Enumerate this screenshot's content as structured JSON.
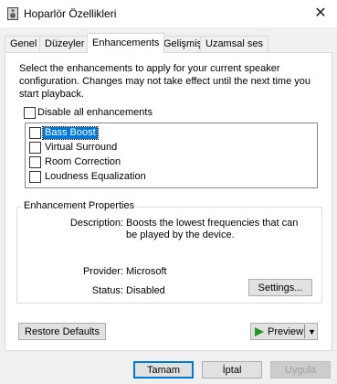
{
  "window": {
    "title": "Hoparlör Özellikleri",
    "close_label": "✕"
  },
  "tabs": [
    {
      "label": "Genel"
    },
    {
      "label": "Düzeyler"
    },
    {
      "label": "Enhancements",
      "active": true
    },
    {
      "label": "Gelişmiş"
    },
    {
      "label": "Uzamsal ses"
    }
  ],
  "enhancements": {
    "description": "Select the enhancements to apply for your current speaker configuration. Changes may not take effect until the next time you start playback.",
    "disable_all_label": "Disable all enhancements",
    "items": [
      {
        "label": "Bass Boost",
        "checked": false,
        "selected": true
      },
      {
        "label": "Virtual Surround",
        "checked": false
      },
      {
        "label": "Room Correction",
        "checked": false
      },
      {
        "label": "Loudness Equalization",
        "checked": false
      }
    ]
  },
  "properties": {
    "group_title": "Enhancement Properties",
    "description_label": "Description:",
    "description_value": "Boosts the lowest frequencies that can be played by the device.",
    "provider_label": "Provider:",
    "provider_value": "Microsoft",
    "status_label": "Status:",
    "status_value": "Disabled",
    "settings_button": "Settings..."
  },
  "footer": {
    "restore_defaults": "Restore Defaults",
    "preview": "Preview",
    "ok": "Tamam",
    "cancel": "İptal",
    "apply": "Uygula"
  }
}
